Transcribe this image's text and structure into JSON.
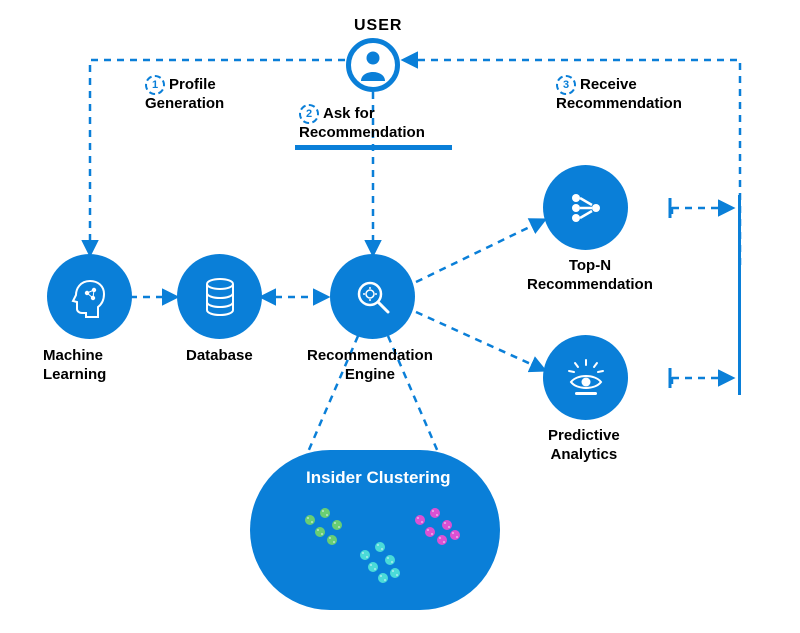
{
  "header": {
    "user_title": "USER"
  },
  "steps": {
    "s1": {
      "num": "1",
      "l1": "Profile",
      "l2": "Generation"
    },
    "s2": {
      "num": "2",
      "l1": "Ask for",
      "l2": "Recommendation"
    },
    "s3": {
      "num": "3",
      "l1": "Receive",
      "l2": "Recommendation"
    }
  },
  "nodes": {
    "ml": {
      "l1": "Machine",
      "l2": "Learning"
    },
    "db": {
      "label": "Database"
    },
    "rec_engine": {
      "l1": "Recommendation",
      "l2": "Engine"
    },
    "topn": {
      "l1": "Top-N",
      "l2": "Recommendation"
    },
    "predictive": {
      "l1": "Predictive",
      "l2": "Analytics"
    }
  },
  "cluster": {
    "title": "Insider Clustering"
  },
  "colors": {
    "brand": "#0a7fd8"
  }
}
